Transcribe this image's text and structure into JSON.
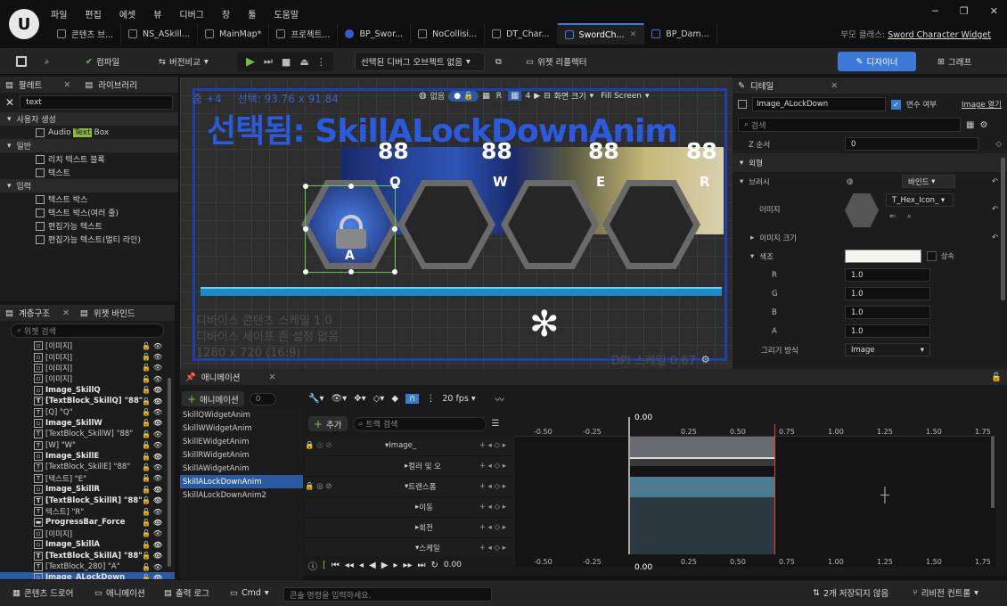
{
  "menu": [
    "파일",
    "편집",
    "에셋",
    "뷰",
    "디버그",
    "창",
    "툴",
    "도움말"
  ],
  "tabs": [
    {
      "label": "콘텐츠 브..."
    },
    {
      "label": "NS_ASkill..."
    },
    {
      "label": "MainMap*"
    },
    {
      "label": "프로젝트..."
    },
    {
      "label": "BP_Swor..."
    },
    {
      "label": "NoCollisi..."
    },
    {
      "label": "DT_Char..."
    },
    {
      "label": "SwordCh..."
    },
    {
      "label": "BP_Dam..."
    }
  ],
  "parent_class": {
    "label": "부모 클래스:",
    "value": "Sword Character Widget"
  },
  "toolbar": {
    "compile": "컴파일",
    "diff": "버전비교",
    "debug_object": "선택된 디버그 오브젝트 없음",
    "widget_reflector": "위젯 리플렉터",
    "designer": "디자이너",
    "graph": "그래프"
  },
  "palette": {
    "tab": "팔레트",
    "tab2": "라이브러리",
    "search_value": "text",
    "categories": [
      {
        "name": "사용자 생성",
        "items": [
          {
            "pre": "Audio ",
            "hl": "Text",
            "post": " Box"
          }
        ]
      },
      {
        "name": "일반",
        "items": [
          {
            "pre": "리치 텍스트 블록",
            "hl": "",
            "post": ""
          },
          {
            "pre": "텍스트",
            "hl": "",
            "post": ""
          }
        ]
      },
      {
        "name": "입력",
        "items": [
          {
            "pre": "텍스트 박스",
            "hl": "",
            "post": ""
          },
          {
            "pre": "텍스트 박스(여러 줄)",
            "hl": "",
            "post": ""
          },
          {
            "pre": "편집가능 텍스트",
            "hl": "",
            "post": ""
          },
          {
            "pre": "편집가능 텍스트(멀티 라인)",
            "hl": "",
            "post": ""
          }
        ]
      }
    ]
  },
  "hierarchy": {
    "tab": "계층구조",
    "tab2": "위젯 바인드",
    "search_placeholder": "위젯 검색",
    "rows": [
      {
        "icon": "img",
        "label": "[이미지]",
        "bold": false
      },
      {
        "icon": "img",
        "label": "[이미지]",
        "bold": false
      },
      {
        "icon": "img",
        "label": "[이미지]",
        "bold": false
      },
      {
        "icon": "img",
        "label": "[이미지]",
        "bold": false
      },
      {
        "icon": "img",
        "label": "Image_SkillQ",
        "bold": true
      },
      {
        "icon": "T",
        "label": "[TextBlock_SkillQ] \"88\"",
        "bold": true
      },
      {
        "icon": "T",
        "label": "[Q] \"Q\"",
        "bold": false
      },
      {
        "icon": "img",
        "label": "Image_SkillW",
        "bold": true
      },
      {
        "icon": "T",
        "label": "[TextBlock_SkillW] \"88\"",
        "bold": false
      },
      {
        "icon": "T",
        "label": "[W] \"W\"",
        "bold": false
      },
      {
        "icon": "img",
        "label": "Image_SkillE",
        "bold": true
      },
      {
        "icon": "T",
        "label": "[TextBlock_SkillE] \"88\"",
        "bold": false
      },
      {
        "icon": "T",
        "label": "[텍스트] \"E\"",
        "bold": false
      },
      {
        "icon": "img",
        "label": "Image_SkillR",
        "bold": true
      },
      {
        "icon": "T",
        "label": "[TextBlock_SkillR] \"88\"",
        "bold": true
      },
      {
        "icon": "T",
        "label": "텍스트] \"R\"",
        "bold": false
      },
      {
        "icon": "bar",
        "label": "ProgressBar_Force",
        "bold": true
      },
      {
        "icon": "img",
        "label": "[이미지]",
        "bold": false
      },
      {
        "icon": "img",
        "label": "Image_SkillA",
        "bold": true
      },
      {
        "icon": "T",
        "label": "[TextBlock_SkillA] \"88\"",
        "bold": true
      },
      {
        "icon": "T",
        "label": "[TextBlock_280] \"A\"",
        "bold": false
      },
      {
        "icon": "img",
        "label": "Image_ALockDown",
        "bold": true,
        "selected": true
      }
    ]
  },
  "viewport": {
    "zoom": "줌 +4",
    "selection": "선택: 93.76 x 91.84",
    "show": "없음",
    "r_label": "R",
    "grid_num": "4",
    "screen_size": "화면 크기",
    "fill_mode": "Fill Screen",
    "title_text": "선택됨: SkillALockDownAnim",
    "skill_counts": [
      "88",
      "88",
      "88",
      "88"
    ],
    "skill_keys": [
      "Q",
      "W",
      "E",
      "R"
    ],
    "lock_key": "A",
    "device_scale": "디바이스 콘텐츠 스케일 1.0",
    "safe_zone": "디바이스 세이프 존 설정 없음",
    "resolution": "1280 x 720 (16:9)",
    "dpi": "DPI 스케일 0.67"
  },
  "details": {
    "tab": "디테일",
    "name_value": "Image_ALockDown",
    "is_variable": "변수 여부",
    "image_more": "Image 열기",
    "search_placeholder": "검색",
    "z_order_label": "Z 순서",
    "z_order_value": "0",
    "appearance": "외형",
    "brush": "브러시",
    "bind": "바인드",
    "image": "이미지",
    "texture": "T_Hex_Icon_",
    "image_size": "이미지 크기",
    "color": "색조",
    "inherit": "상속",
    "r_label": "R",
    "g_label": "G",
    "b_label": "B",
    "a_label": "A",
    "r": "1.0",
    "g": "1.0",
    "b": "1.0",
    "a": "1.0",
    "draw_as_label": "그리기 방식",
    "draw_as": "Image"
  },
  "animations": {
    "tab": "애니메이션",
    "add_label": "애니메이션",
    "count": "0",
    "list": [
      "SkillQWidgetAnim",
      "SkillWWidgetAnim",
      "SkillEWidgetAnim",
      "SkillRWidgetAnim",
      "SkillAWidgetAnim",
      "SkillALockDownAnim",
      "SkillALockDownAnim2"
    ],
    "selected_index": 5,
    "add_track": "추가",
    "track_search": "트랙 검색",
    "fps": "20 fps",
    "current_time": "0.00",
    "tracks": [
      {
        "label": "Image_",
        "indent": 0
      },
      {
        "label": "컬러 및 오",
        "indent": 1
      },
      {
        "label": "트랜스폼",
        "indent": 1
      },
      {
        "label": "이동",
        "indent": 2
      },
      {
        "label": "회전",
        "indent": 2
      },
      {
        "label": "스케일",
        "indent": 2
      }
    ],
    "ticks": [
      "-0.50",
      "-0.25",
      "0.25",
      "0.50",
      "0.75",
      "1.00",
      "1.25",
      "1.50",
      "1.75"
    ],
    "time_end": "0.00"
  },
  "statusbar": {
    "content_drawer": "콘텐츠 드로어",
    "animation": "애니메이션",
    "output_log": "출력 로그",
    "cmd": "Cmd",
    "console_placeholder": "콘솔 명령을 입력하세요.",
    "unsaved": "2개 저장되지 않음",
    "revision": "리비전 컨트롤"
  },
  "colors": {
    "accent": "#3d7ad8",
    "selection": "#2b5aa3",
    "title_blue": "#2a5ae0",
    "skillbar": "#1a8ac8"
  }
}
